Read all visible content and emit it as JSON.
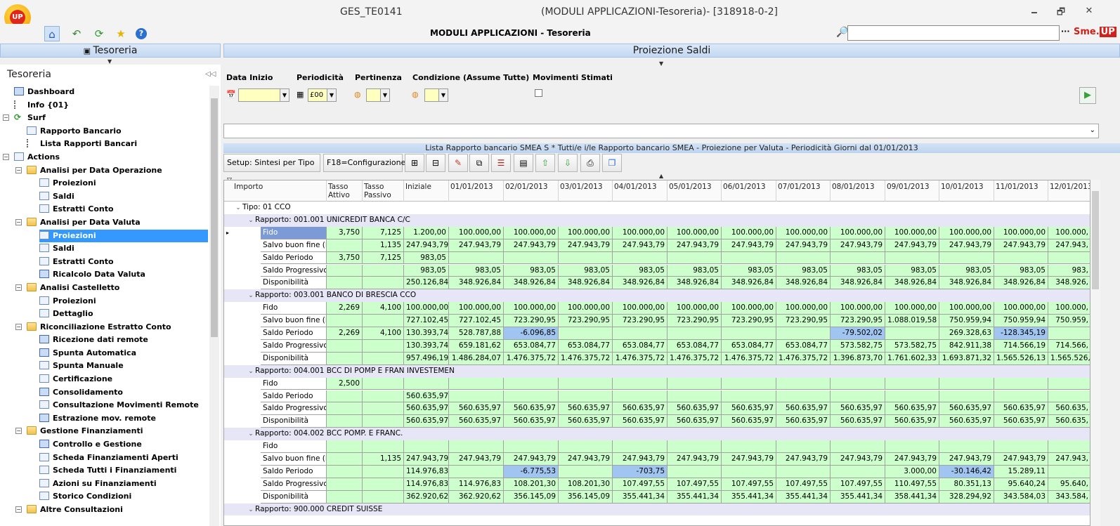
{
  "titlebar": {
    "logo_text": "UP",
    "app_code": "GES_TE0141",
    "window_title": "(MODULI APPLICAZIONI-Tesoreria)- [318918-0-2]",
    "min": "🗕",
    "restore": "🗗",
    "close": "✕"
  },
  "toolbar": {
    "center_title": "MODULI APPLICAZIONI - Tesoreria",
    "search_value": "",
    "ellipsis": "···",
    "brand_pre": "Sme.",
    "brand_post": "UP"
  },
  "left_panel": {
    "header": "Tesoreria",
    "title": "Tesoreria"
  },
  "tree": [
    {
      "label": "Dashboard",
      "level": 1,
      "icon": "dashboard-icon"
    },
    {
      "label": "Info {01}",
      "level": 1,
      "icon": "info-list-icon"
    },
    {
      "label": "Surf",
      "level": 0,
      "icon": "surf-refresh-icon",
      "expander": "−"
    },
    {
      "label": "Rapporto Bancario",
      "level": 2,
      "icon": "table-icon"
    },
    {
      "label": "Lista Rapporti Bancari",
      "level": 2,
      "icon": "list-icon"
    },
    {
      "label": "Actions",
      "level": 0,
      "icon": "actions-icon",
      "expander": "−"
    },
    {
      "label": "Analisi per Data Operazione",
      "level": 1,
      "icon": "folder-icon",
      "expander": "−"
    },
    {
      "label": "Proiezioni",
      "level": 2,
      "icon": "page-icon"
    },
    {
      "label": "Saldi",
      "level": 2,
      "icon": "page-icon"
    },
    {
      "label": "Estratti Conto",
      "level": 2,
      "icon": "page-icon"
    },
    {
      "label": "Analisi per Data Valuta",
      "level": 1,
      "icon": "folder-icon",
      "expander": "−"
    },
    {
      "label": "Proiezioni",
      "level": 2,
      "icon": "page-icon",
      "selected": true
    },
    {
      "label": "Saldi",
      "level": 2,
      "icon": "page-icon"
    },
    {
      "label": "Estratti Conto",
      "level": 2,
      "icon": "page-icon"
    },
    {
      "label": "Ricalcolo Data Valuta",
      "level": 2,
      "icon": "monitor-icon"
    },
    {
      "label": "Analisi Castelletto",
      "level": 1,
      "icon": "folder-icon",
      "expander": "−"
    },
    {
      "label": "Proiezioni",
      "level": 2,
      "icon": "page-icon"
    },
    {
      "label": "Dettaglio",
      "level": 2,
      "icon": "page-icon"
    },
    {
      "label": "Riconciliazione Estratto Conto",
      "level": 1,
      "icon": "folder-icon",
      "expander": "−"
    },
    {
      "label": "Ricezione dati remote",
      "level": 2,
      "icon": "monitor-icon"
    },
    {
      "label": "Spunta Automatica",
      "level": 2,
      "icon": "monitor-icon"
    },
    {
      "label": "Spunta Manuale",
      "level": 2,
      "icon": "page-icon"
    },
    {
      "label": "Certificazione",
      "level": 2,
      "icon": "page-icon"
    },
    {
      "label": "Consolidamento",
      "level": 2,
      "icon": "monitor-icon"
    },
    {
      "label": "Consultazione Movimenti Remote",
      "level": 2,
      "icon": "page-icon"
    },
    {
      "label": "Estrazione mov. remote",
      "level": 2,
      "icon": "monitor-icon"
    },
    {
      "label": "Gestione Finanziamenti",
      "level": 1,
      "icon": "folder-icon",
      "expander": "−"
    },
    {
      "label": "Controllo e Gestione",
      "level": 2,
      "icon": "monitor-icon"
    },
    {
      "label": "Scheda Finanziamenti Aperti",
      "level": 2,
      "icon": "page-icon"
    },
    {
      "label": "Scheda Tutti i Finanziamenti",
      "level": 2,
      "icon": "page-icon"
    },
    {
      "label": "Azioni su Finanziamenti",
      "level": 2,
      "icon": "page-icon"
    },
    {
      "label": "Storico Condizioni",
      "level": 2,
      "icon": "page-icon"
    },
    {
      "label": "Altre Consultazioni",
      "level": 1,
      "icon": "folder-icon",
      "expander": "−"
    }
  ],
  "main": {
    "header": "Proiezione Saldi",
    "filters": {
      "data_inizio_label": "Data Inizio",
      "data_inizio_value": "",
      "periodicita_label": "Periodicità",
      "periodicita_value": "£00",
      "pertinenza_label": "Pertinenza",
      "pertinenza_value": "",
      "condizione_label": "Condizione (Assume Tutte)",
      "condizione_value": "",
      "movimenti_label": "Movimenti Stimati",
      "movimenti_checked": false
    },
    "list_caption": "Lista Rapporto bancario SMEA S * Tutti/e i/le Rapporto bancario SMEA - Proiezione per Valuta - Periodicità Giorni dal 01/01/2013",
    "setup_label": "Setup: Sintesi per Tipo",
    "config_label": "F18=Configurazione",
    "headers": [
      "Importo",
      "Tasso Attivo",
      "Tasso Passivo",
      "Iniziale",
      "01/01/2013",
      "02/01/2013",
      "03/01/2013",
      "04/01/2013",
      "05/01/2013",
      "06/01/2013",
      "07/01/2013",
      "08/01/2013",
      "09/01/2013",
      "10/01/2013",
      "11/01/2013",
      "12/01/2013"
    ],
    "tipo_group": "Tipo: 01 CCO",
    "rapporti": [
      {
        "title": "Rapporto: 001.001 UNICREDIT BANCA C/C",
        "rows": [
          {
            "label": "Fido",
            "att": "3,750",
            "pas": "7,125",
            "vals": [
              "1.200,00",
              "100.000,00",
              "100.000,00",
              "100.000,00",
              "100.000,00",
              "100.000,00",
              "100.000,00",
              "100.000,00",
              "100.000,00",
              "100.000,00",
              "100.000,00",
              "100.000,00",
              "100.000,"
            ],
            "selected": true
          },
          {
            "label": "Salvo buon fine (P)",
            "att": "",
            "pas": "1,135",
            "vals": [
              "247.943,79",
              "247.943,79",
              "247.943,79",
              "247.943,79",
              "247.943,79",
              "247.943,79",
              "247.943,79",
              "247.943,79",
              "247.943,79",
              "247.943,79",
              "247.943,79",
              "247.943,79",
              "247.943,"
            ]
          },
          {
            "label": "Saldo Periodo",
            "att": "3,750",
            "pas": "7,125",
            "vals": [
              "983,05",
              "",
              "",
              "",
              "",
              "",
              "",
              "",
              "",
              "",
              "",
              "",
              ""
            ]
          },
          {
            "label": "Saldo Progressivo",
            "att": "",
            "pas": "",
            "vals": [
              "983,05",
              "983,05",
              "983,05",
              "983,05",
              "983,05",
              "983,05",
              "983,05",
              "983,05",
              "983,05",
              "983,05",
              "983,05",
              "983,05",
              "983,"
            ]
          },
          {
            "label": "Disponibilità",
            "att": "",
            "pas": "",
            "vals": [
              "250.126,84",
              "348.926,84",
              "348.926,84",
              "348.926,84",
              "348.926,84",
              "348.926,84",
              "348.926,84",
              "348.926,84",
              "348.926,84",
              "348.926,84",
              "348.926,84",
              "348.926,84",
              "348.926,"
            ]
          }
        ]
      },
      {
        "title": "Rapporto: 003.001 BANCO DI BRESCIA CCO",
        "rows": [
          {
            "label": "Fido",
            "att": "2,269",
            "pas": "4,100",
            "vals": [
              "100.000,00",
              "100.000,00",
              "100.000,00",
              "100.000,00",
              "100.000,00",
              "100.000,00",
              "100.000,00",
              "100.000,00",
              "100.000,00",
              "100.000,00",
              "100.000,00",
              "100.000,00",
              "100.000,"
            ]
          },
          {
            "label": "Salvo buon fine (P)",
            "att": "",
            "pas": "",
            "vals": [
              "727.102,45",
              "727.102,45",
              "723.290,95",
              "723.290,95",
              "723.290,95",
              "723.290,95",
              "723.290,95",
              "723.290,95",
              "723.290,95",
              "1.088.019,58",
              "750.959,94",
              "750.959,94",
              "750.959,"
            ]
          },
          {
            "label": "Saldo Periodo",
            "att": "2,269",
            "pas": "4,100",
            "vals": [
              "130.393,74",
              "528.787,88",
              "-6.096,85",
              "",
              "",
              "",
              "",
              "",
              "-79.502,02",
              "",
              "269.328,63",
              "-128.345,19",
              ""
            ],
            "neg": [
              2,
              8,
              11
            ]
          },
          {
            "label": "Saldo Progressivo",
            "att": "",
            "pas": "",
            "vals": [
              "130.393,74",
              "659.181,62",
              "653.084,77",
              "653.084,77",
              "653.084,77",
              "653.084,77",
              "653.084,77",
              "653.084,77",
              "573.582,75",
              "573.582,75",
              "842.911,38",
              "714.566,19",
              "714.566,"
            ]
          },
          {
            "label": "Disponibilità",
            "att": "",
            "pas": "",
            "vals": [
              "957.496,19",
              "1.486.284,07",
              "1.476.375,72",
              "1.476.375,72",
              "1.476.375,72",
              "1.476.375,72",
              "1.476.375,72",
              "1.476.375,72",
              "1.396.873,70",
              "1.761.602,33",
              "1.693.871,32",
              "1.565.526,13",
              "1.565.526,"
            ]
          }
        ]
      },
      {
        "title": "Rapporto: 004.001 BCC DI POMP E FRAN INVESTEMEN",
        "rows": [
          {
            "label": "Fido",
            "att": "2,500",
            "pas": "",
            "vals": [
              "",
              "",
              "",
              "",
              "",
              "",
              "",
              "",
              "",
              "",
              "",
              "",
              ""
            ]
          },
          {
            "label": "Saldo Periodo",
            "att": "",
            "pas": "",
            "vals": [
              "560.635,97",
              "",
              "",
              "",
              "",
              "",
              "",
              "",
              "",
              "",
              "",
              "",
              ""
            ]
          },
          {
            "label": "Saldo Progressivo",
            "att": "",
            "pas": "",
            "vals": [
              "560.635,97",
              "560.635,97",
              "560.635,97",
              "560.635,97",
              "560.635,97",
              "560.635,97",
              "560.635,97",
              "560.635,97",
              "560.635,97",
              "560.635,97",
              "560.635,97",
              "560.635,97",
              "560.635,"
            ]
          },
          {
            "label": "Disponibilità",
            "att": "",
            "pas": "",
            "vals": [
              "560.635,97",
              "560.635,97",
              "560.635,97",
              "560.635,97",
              "560.635,97",
              "560.635,97",
              "560.635,97",
              "560.635,97",
              "560.635,97",
              "560.635,97",
              "560.635,97",
              "560.635,97",
              "560.635,"
            ]
          }
        ]
      },
      {
        "title": "Rapporto: 004.002 BCC POMP. E FRANC.",
        "rows": [
          {
            "label": "Fido",
            "att": "",
            "pas": "",
            "vals": [
              "",
              "",
              "",
              "",
              "",
              "",
              "",
              "",
              "",
              "",
              "",
              "",
              ""
            ]
          },
          {
            "label": "Salvo buon fine (P)",
            "att": "",
            "pas": "1,135",
            "vals": [
              "247.943,79",
              "247.943,79",
              "247.943,79",
              "247.943,79",
              "247.943,79",
              "247.943,79",
              "247.943,79",
              "247.943,79",
              "247.943,79",
              "247.943,79",
              "247.943,79",
              "247.943,79",
              "247.943,"
            ]
          },
          {
            "label": "Saldo Periodo",
            "att": "",
            "pas": "",
            "vals": [
              "114.976,83",
              "",
              "-6.775,53",
              "",
              "-703,75",
              "",
              "",
              "",
              "",
              "3.000,00",
              "-30.146,42",
              "15.289,11",
              ""
            ],
            "neg": [
              2,
              4,
              10
            ]
          },
          {
            "label": "Saldo Progressivo",
            "att": "",
            "pas": "",
            "vals": [
              "114.976,83",
              "114.976,83",
              "108.201,30",
              "108.201,30",
              "107.497,55",
              "107.497,55",
              "107.497,55",
              "107.497,55",
              "107.497,55",
              "110.497,55",
              "80.351,13",
              "95.640,24",
              "95.640,"
            ]
          },
          {
            "label": "Disponibilità",
            "att": "",
            "pas": "",
            "vals": [
              "362.920,62",
              "362.920,62",
              "356.145,09",
              "356.145,09",
              "355.441,34",
              "355.441,34",
              "355.441,34",
              "355.441,34",
              "355.441,34",
              "358.441,34",
              "328.294,92",
              "343.584,03",
              "343.584,"
            ]
          }
        ]
      },
      {
        "title": "Rapporto: 900.000 CREDIT SUISSE",
        "rows": []
      }
    ]
  }
}
